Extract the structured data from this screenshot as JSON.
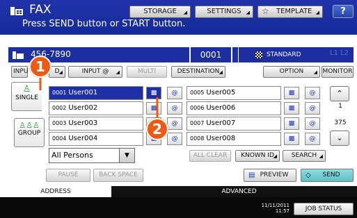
{
  "header": {
    "title": "FAX",
    "message": "Press SEND button or START button.",
    "buttons": {
      "storage": "STORAGE",
      "settings": "SETTINGS",
      "template": "TEMPLATE",
      "help": "?"
    }
  },
  "status": {
    "number": "456-7890",
    "sequence": "0001",
    "mode": "STANDARD",
    "lines": "L1 L2"
  },
  "options": {
    "input": "INPU",
    "input_d": "D",
    "input_at": "INPUT @",
    "multi": "MULTI",
    "destination": "DESTINATION",
    "option": "OPTION",
    "monitor": "MONITOR"
  },
  "sidebar": {
    "single": "SINGLE",
    "group": "GROUP"
  },
  "entries_left": [
    {
      "num": "0001",
      "name": "User001"
    },
    {
      "num": "0002",
      "name": "User002"
    },
    {
      "num": "0003",
      "name": "User003"
    },
    {
      "num": "0004",
      "name": "User004"
    }
  ],
  "entries_right": [
    {
      "num": "0005",
      "name": "User005"
    },
    {
      "num": "0006",
      "name": "User006"
    },
    {
      "num": "0007",
      "name": "User007"
    },
    {
      "num": "0008",
      "name": "User008"
    }
  ],
  "pagination": {
    "page": "1",
    "total": "375"
  },
  "filter": {
    "selected": "All Persons",
    "all_clear": "ALL CLEAR",
    "known_id": "KNOWN ID",
    "search": "SEARCH"
  },
  "actions": {
    "pause": "PAUSE",
    "backspace": "BACK SPACE",
    "preview": "PREVIEW",
    "send": "SEND"
  },
  "tabs": {
    "address": "ADDRESS",
    "advanced": "ADVANCED"
  },
  "footer": {
    "date": "11/11/2011",
    "time": "11:57",
    "job_status": "JOB STATUS"
  },
  "callouts": {
    "one": "1",
    "two": "2"
  }
}
